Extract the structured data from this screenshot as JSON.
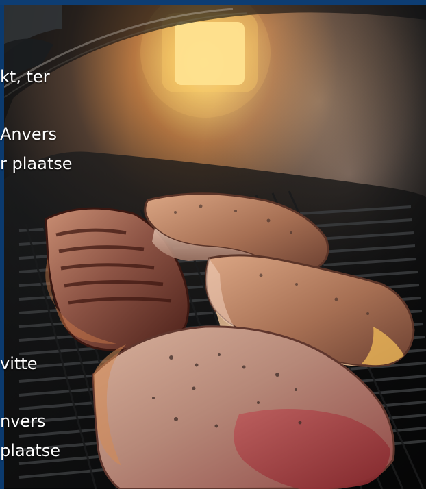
{
  "overlay_lines": [
    "kt, ter",
    "Anvers",
    "r plaatse",
    "vitte",
    "nvers",
    " plaatse"
  ]
}
